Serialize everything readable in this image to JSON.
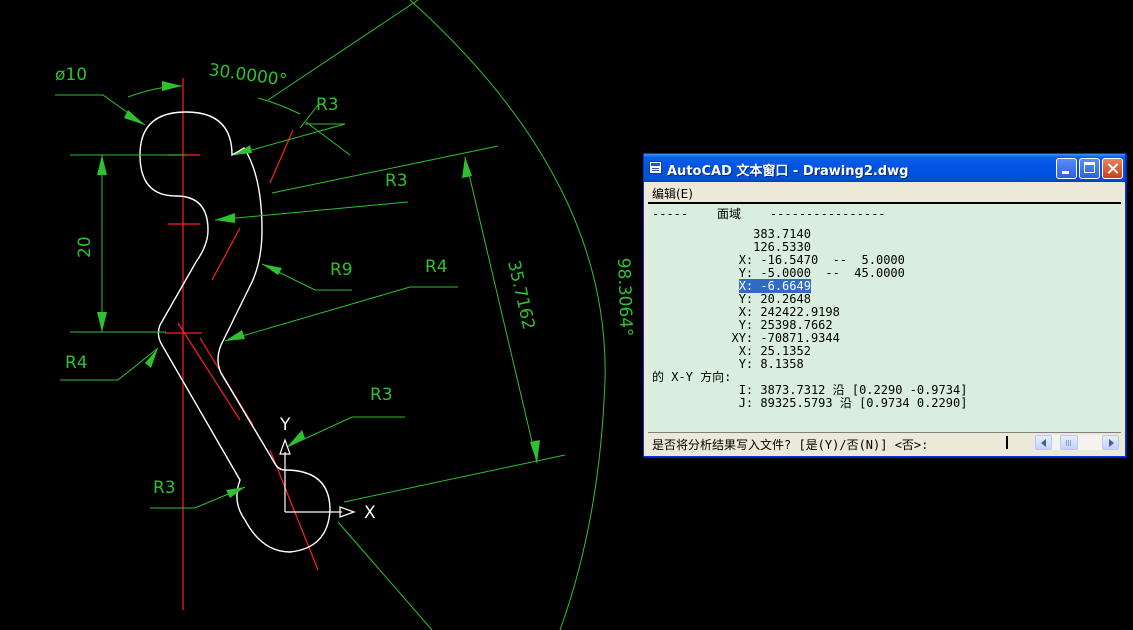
{
  "drawing": {
    "labels": {
      "diameter": "ø10",
      "angle": "30.0000°",
      "r3_top": "R3",
      "r3_mid": "R3",
      "r9": "R9",
      "r4_right": "R4",
      "r4_left": "R4",
      "r3_lower": "R3",
      "r3_bottom": "R3",
      "dim_20": "20",
      "dim_aligned": "35.7162",
      "dim_arc_angle": "98.3064°",
      "ucs_y": "Y",
      "ucs_x": "X"
    },
    "colors": {
      "background": "#000000",
      "dimension": "#2fc02f",
      "centerline": "#ff2020",
      "geometry": "#ffffff"
    }
  },
  "text_window": {
    "title": "AutoCAD 文本窗口 - Drawing2.dwg",
    "menu": {
      "edit": "编辑(E)"
    },
    "lines": {
      "header": "-----    面域    ----------------",
      "l1": "              383.7140",
      "l2": "              126.5330",
      "l3": "            X: -16.5470  --  5.0000",
      "l4": "            Y: -5.0000  --  45.0000",
      "l5_label": "            ",
      "l5_highlight": "X: -6.6649",
      "l6": "            Y: 20.2648",
      "l7": "            X: 242422.9198",
      "l8": "            Y: 25398.7662",
      "l9": "           XY: -70871.9344",
      "l10": "            X: 25.1352",
      "l11": "            Y: 8.1358",
      "l12": "的 X-Y 方向:",
      "l13": "            I: 3873.7312 沿 [0.2290 -0.9734]",
      "l14": "            J: 89325.5793 沿 [0.9734 0.2290]"
    },
    "prompt": "是否将分析结果写入文件? [是(Y)/否(N)] <否>:"
  }
}
